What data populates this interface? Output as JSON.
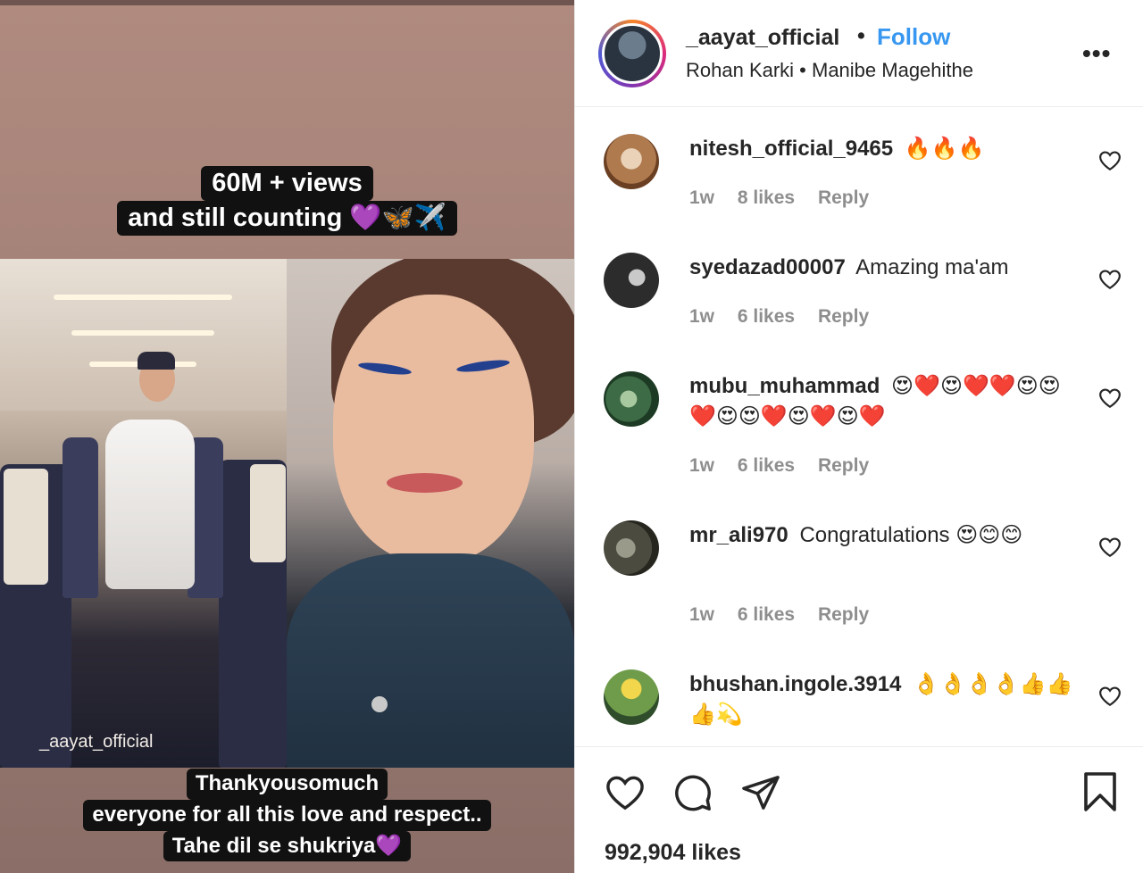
{
  "media": {
    "top_caption": [
      "60M + views",
      "and still counting 💜🦋✈️"
    ],
    "bottom_caption": [
      "Thankyousomuch",
      "everyone for all this love and respect..",
      "Tahe dil se shukriya💜"
    ],
    "watermark": "_aayat_official"
  },
  "post_header": {
    "author": "_aayat_official",
    "separator": "•",
    "follow_label": "Follow",
    "audio_info": "Rohan Karki • Manibe Magehithe",
    "more_icon": "more-horizontal-icon",
    "more_glyph": "•••"
  },
  "comments": [
    {
      "user": "nitesh_official_9465",
      "text": "🔥🔥🔥",
      "time": "1w",
      "likes": "8 likes",
      "reply": "Reply"
    },
    {
      "user": "syedazad00007",
      "text": "Amazing ma'am",
      "time": "1w",
      "likes": "6 likes",
      "reply": "Reply"
    },
    {
      "user": "mubu_muhammad",
      "text": "😍❤️😍❤️❤️😍😍❤️😍😍❤️😍❤️😍❤️",
      "time": "1w",
      "likes": "6 likes",
      "reply": "Reply"
    },
    {
      "user": "mr_ali970",
      "text": "Congratulations 😍😊😊",
      "time": "1w",
      "likes": "6 likes",
      "reply": "Reply"
    },
    {
      "user": "bhushan.ingole.3914",
      "text": "👌👌👌👌👍👍👍💫",
      "time": "",
      "likes": "",
      "reply": ""
    }
  ],
  "actions": {
    "like_icon": "heart-icon",
    "comment_icon": "comment-icon",
    "share_icon": "paper-plane-icon",
    "save_icon": "bookmark-icon",
    "likes_count": "992,904 likes"
  },
  "colors": {
    "follow_blue": "#3897f0",
    "text_dark": "#262626",
    "meta_gray": "#8e8e8e",
    "caption_bg": "#111111",
    "story_ring": "#dd2a7b"
  }
}
